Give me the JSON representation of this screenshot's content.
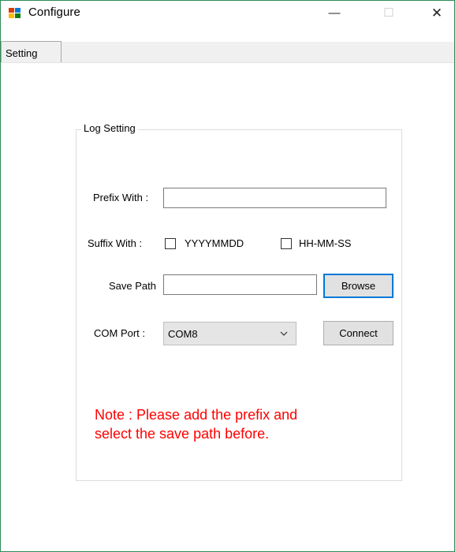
{
  "window": {
    "title": "Configure",
    "controls": {
      "minimize": "—",
      "maximize": "☐",
      "close": "✕"
    }
  },
  "tabs": [
    {
      "label": "Setting",
      "selected": true
    }
  ],
  "group": {
    "title": "Log Setting"
  },
  "prefix": {
    "label": "Prefix With :",
    "value": ""
  },
  "suffix": {
    "label": "Suffix With :",
    "options": [
      {
        "label": "YYYYMMDD",
        "checked": false
      },
      {
        "label": "HH-MM-SS",
        "checked": false
      }
    ]
  },
  "save_path": {
    "label": "Save Path",
    "value": "",
    "browse_label": "Browse"
  },
  "com_port": {
    "label": "COM Port :",
    "selected": "COM8",
    "connect_label": "Connect"
  },
  "note": {
    "line1": "Note : Please add the prefix and",
    "line2": "select the save path before."
  },
  "colors": {
    "note": "#ff0000",
    "focus": "#0078d7",
    "window_border": "#2e8b57"
  }
}
